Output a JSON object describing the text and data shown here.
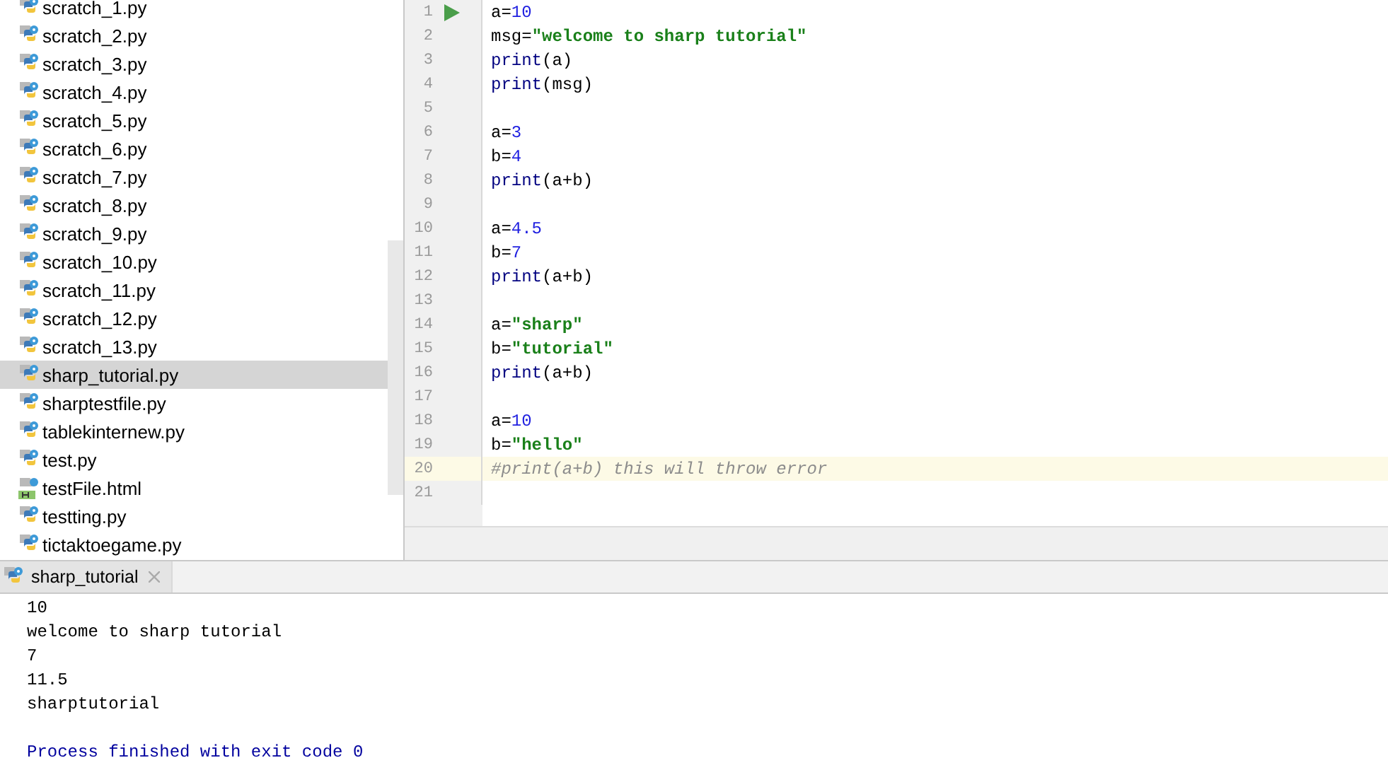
{
  "project_tree": {
    "items": [
      {
        "label": "scratch_1.py",
        "kind": "python",
        "selected": false
      },
      {
        "label": "scratch_2.py",
        "kind": "python",
        "selected": false
      },
      {
        "label": "scratch_3.py",
        "kind": "python",
        "selected": false
      },
      {
        "label": "scratch_4.py",
        "kind": "python",
        "selected": false
      },
      {
        "label": "scratch_5.py",
        "kind": "python",
        "selected": false
      },
      {
        "label": "scratch_6.py",
        "kind": "python",
        "selected": false
      },
      {
        "label": "scratch_7.py",
        "kind": "python",
        "selected": false
      },
      {
        "label": "scratch_8.py",
        "kind": "python",
        "selected": false
      },
      {
        "label": "scratch_9.py",
        "kind": "python",
        "selected": false
      },
      {
        "label": "scratch_10.py",
        "kind": "python",
        "selected": false
      },
      {
        "label": "scratch_11.py",
        "kind": "python",
        "selected": false
      },
      {
        "label": "scratch_12.py",
        "kind": "python",
        "selected": false
      },
      {
        "label": "scratch_13.py",
        "kind": "python",
        "selected": false
      },
      {
        "label": "sharp_tutorial.py",
        "kind": "python",
        "selected": true
      },
      {
        "label": "sharptestfile.py",
        "kind": "python",
        "selected": false
      },
      {
        "label": "tablekinternew.py",
        "kind": "python",
        "selected": false
      },
      {
        "label": "test.py",
        "kind": "python",
        "selected": false
      },
      {
        "label": "testFile.html",
        "kind": "html",
        "selected": false
      },
      {
        "label": "testting.py",
        "kind": "python",
        "selected": false
      },
      {
        "label": "tictaktoegame.py",
        "kind": "python",
        "selected": false
      }
    ]
  },
  "editor": {
    "lines": [
      {
        "number": "1",
        "run_marker": true,
        "current": false,
        "tokens": [
          {
            "text": "a=",
            "kind": "plain"
          },
          {
            "text": "10",
            "kind": "number"
          }
        ]
      },
      {
        "number": "2",
        "run_marker": false,
        "current": false,
        "tokens": [
          {
            "text": "msg=",
            "kind": "plain"
          },
          {
            "text": "\"welcome to sharp tutorial\"",
            "kind": "string"
          }
        ]
      },
      {
        "number": "3",
        "run_marker": false,
        "current": false,
        "tokens": [
          {
            "text": "print",
            "kind": "builtin"
          },
          {
            "text": "(a)",
            "kind": "plain"
          }
        ]
      },
      {
        "number": "4",
        "run_marker": false,
        "current": false,
        "tokens": [
          {
            "text": "print",
            "kind": "builtin"
          },
          {
            "text": "(msg)",
            "kind": "plain"
          }
        ]
      },
      {
        "number": "5",
        "run_marker": false,
        "current": false
      },
      {
        "number": "6",
        "run_marker": false,
        "current": false,
        "tokens": [
          {
            "text": "a=",
            "kind": "plain"
          },
          {
            "text": "3",
            "kind": "number"
          }
        ]
      },
      {
        "number": "7",
        "run_marker": false,
        "current": false,
        "tokens": [
          {
            "text": "b=",
            "kind": "plain"
          },
          {
            "text": "4",
            "kind": "number"
          }
        ]
      },
      {
        "number": "8",
        "run_marker": false,
        "current": false,
        "tokens": [
          {
            "text": "print",
            "kind": "builtin"
          },
          {
            "text": "(a+b)",
            "kind": "plain"
          }
        ]
      },
      {
        "number": "9",
        "run_marker": false,
        "current": false
      },
      {
        "number": "10",
        "run_marker": false,
        "current": false,
        "tokens": [
          {
            "text": "a=",
            "kind": "plain"
          },
          {
            "text": "4.5",
            "kind": "number"
          }
        ]
      },
      {
        "number": "11",
        "run_marker": false,
        "current": false,
        "tokens": [
          {
            "text": "b=",
            "kind": "plain"
          },
          {
            "text": "7",
            "kind": "number"
          }
        ]
      },
      {
        "number": "12",
        "run_marker": false,
        "current": false,
        "tokens": [
          {
            "text": "print",
            "kind": "builtin"
          },
          {
            "text": "(a+b)",
            "kind": "plain"
          }
        ]
      },
      {
        "number": "13",
        "run_marker": false,
        "current": false
      },
      {
        "number": "14",
        "run_marker": false,
        "current": false,
        "tokens": [
          {
            "text": "a=",
            "kind": "plain"
          },
          {
            "text": "\"sharp\"",
            "kind": "string"
          }
        ]
      },
      {
        "number": "15",
        "run_marker": false,
        "current": false,
        "tokens": [
          {
            "text": "b=",
            "kind": "plain"
          },
          {
            "text": "\"tutorial\"",
            "kind": "string"
          }
        ]
      },
      {
        "number": "16",
        "run_marker": false,
        "current": false,
        "tokens": [
          {
            "text": "print",
            "kind": "builtin"
          },
          {
            "text": "(a+b)",
            "kind": "plain"
          }
        ]
      },
      {
        "number": "17",
        "run_marker": false,
        "current": false
      },
      {
        "number": "18",
        "run_marker": false,
        "current": false,
        "tokens": [
          {
            "text": "a=",
            "kind": "plain"
          },
          {
            "text": "10",
            "kind": "number"
          }
        ]
      },
      {
        "number": "19",
        "run_marker": false,
        "current": false,
        "tokens": [
          {
            "text": "b=",
            "kind": "plain"
          },
          {
            "text": "\"hello\"",
            "kind": "string"
          }
        ]
      },
      {
        "number": "20",
        "run_marker": false,
        "current": true,
        "tokens": [
          {
            "text": "#print(a+b) this will throw error",
            "kind": "comment"
          }
        ]
      },
      {
        "number": "21",
        "run_marker": false,
        "current": false
      }
    ]
  },
  "run_panel": {
    "tab": {
      "label": "sharp_tutorial",
      "selected": true
    },
    "output": [
      {
        "text": "10",
        "kind": "output"
      },
      {
        "text": "welcome to sharp tutorial",
        "kind": "output"
      },
      {
        "text": "7",
        "kind": "output"
      },
      {
        "text": "11.5",
        "kind": "output"
      },
      {
        "text": "sharptutorial",
        "kind": "output"
      },
      {
        "text": "Process finished with exit code 0",
        "kind": "system"
      }
    ]
  }
}
